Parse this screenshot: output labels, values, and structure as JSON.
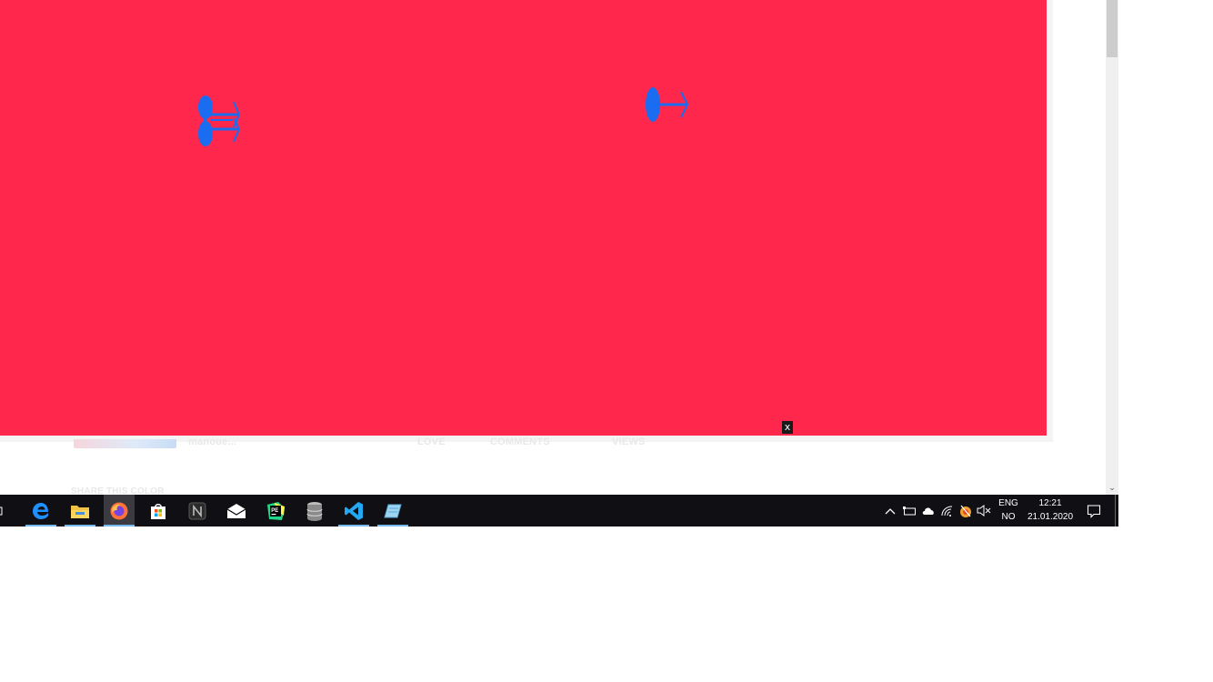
{
  "overlay": {
    "background_color": "#ff284c",
    "pin_color": "#1a6cf0",
    "close_label": "x"
  },
  "background_page": {
    "author_snippet": "manoue...",
    "stat_labels": [
      "LOVE",
      "COMMENTS",
      "VIEWS"
    ],
    "share_heading": "SHARE THIS COLOR"
  },
  "scrollbar": {
    "down_arrow": "⌄"
  },
  "taskbar": {
    "apps": [
      {
        "name": "task-view",
        "icon": "task-view-icon"
      },
      {
        "name": "edge",
        "icon": "edge-icon"
      },
      {
        "name": "file-explorer",
        "icon": "folder-icon"
      },
      {
        "name": "firefox",
        "icon": "firefox-icon"
      },
      {
        "name": "microsoft-store",
        "icon": "store-icon"
      },
      {
        "name": "notion",
        "icon": "notion-icon"
      },
      {
        "name": "mail",
        "icon": "mail-icon"
      },
      {
        "name": "pycharm",
        "icon": "pycharm-icon"
      },
      {
        "name": "database",
        "icon": "database-icon"
      },
      {
        "name": "vscode",
        "icon": "vscode-icon"
      },
      {
        "name": "app",
        "icon": "app-icon"
      }
    ],
    "tray": {
      "language_top": "ENG",
      "language_bottom": "NO",
      "time": "12:21",
      "date": "21.01.2020"
    }
  }
}
